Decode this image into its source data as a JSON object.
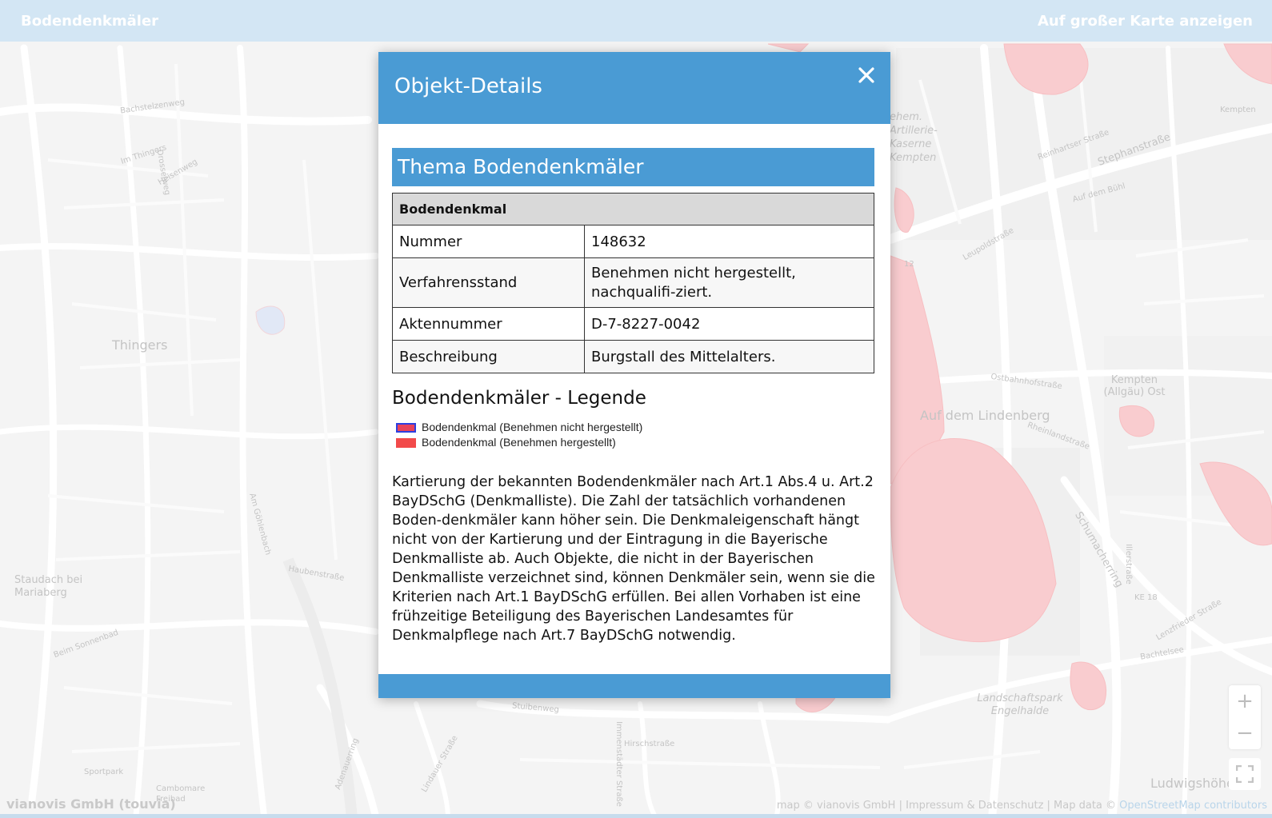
{
  "topbar": {
    "title": "Bodendenkmäler",
    "big_map_link": "Auf großer Karte anzeigen"
  },
  "map": {
    "labels": [
      "Thingers",
      "Staudach bei Mariaberg",
      "Kempten (Allgäu) Ost",
      "Auf dem Lindenberg",
      "Landschaftspark Engelhalde",
      "Ludwigshöhe",
      "ehem. Artillerie-Kaserne Kempten",
      "Stephanstraße",
      "Schumacherring",
      "Kempten",
      "Bachstelzenweg",
      "Im Thingers",
      "Drosselweg",
      "Heisenweg",
      "Am Göhlenbach",
      "Beim Sonnenbad",
      "Haubenstraße",
      "Stuibenweg",
      "Lenzfrieder Straße",
      "Ostbahnhofstraße",
      "Reinhartser Straße",
      "Auf dem Bühl",
      "Rheinlandstraße",
      "Adenauerring",
      "Lindauer Straße",
      "Immenstädter Straße",
      "KE 18",
      "Sportpark",
      "Cambomare Freibad",
      "Hirschstraße",
      "Bachtelsee",
      "Illerstraße",
      "12",
      "Leupoldstraße"
    ],
    "colors": {
      "monument_fill": "#f5a3a8",
      "monument_stroke": "#f08a90"
    }
  },
  "controls": {
    "zoom_in": "+",
    "zoom_out": "−",
    "fullscreen_icon": "fullscreen-icon"
  },
  "attribution": {
    "left": "vianovis GmbH (touvia)",
    "right_prefix": "map © vianovis GmbH | Impressum & Datenschutz | Map data © ",
    "right_link": "OpenStreetMap contributors"
  },
  "modal": {
    "title": "Objekt-Details",
    "close_icon": "close-icon",
    "theme_banner": "Thema Bodendenkmäler",
    "table": {
      "header": "Bodendenkmal",
      "rows": [
        {
          "key": "Nummer",
          "value": "148632"
        },
        {
          "key": "Verfahrensstand",
          "value": "Benehmen nicht hergestellt, nachqualifi-ziert."
        },
        {
          "key": "Aktennummer",
          "value": "D-7-8227-0042"
        },
        {
          "key": "Beschreibung",
          "value": "Burgstall des Mittelalters."
        }
      ]
    },
    "legend": {
      "title": "Bodendenkmäler - Legende",
      "items": [
        {
          "label": "Bodendenkmal (Benehmen nicht hergestellt)",
          "color": "#e8445a",
          "stroke": "#2d3fe0"
        },
        {
          "label": "Bodendenkmal (Benehmen hergestellt)",
          "color": "#f24a4a",
          "stroke": "#f24a4a"
        }
      ]
    },
    "description": "Kartierung der bekannten Bodendenkmäler nach Art.1 Abs.4 u. Art.2 BayDSchG (Denkmalliste). Die Zahl der tatsächlich vorhandenen Boden-denkmäler kann höher sein. Die Denkmaleigenschaft hängt nicht von der Kartierung und der Eintragung in die Bayerische Denkmalliste ab. Auch Objekte, die nicht in der Bayerischen Denkmalliste verzeichnet sind, können Denkmäler sein, wenn sie die Kriterien nach Art.1 BayDSchG erfüllen. Bei allen Vorhaben ist eine frühzeitige Beteiligung des Bayerischen Landesamtes für Denkmalpflege nach Art.7 BayDSchG notwendig."
  }
}
